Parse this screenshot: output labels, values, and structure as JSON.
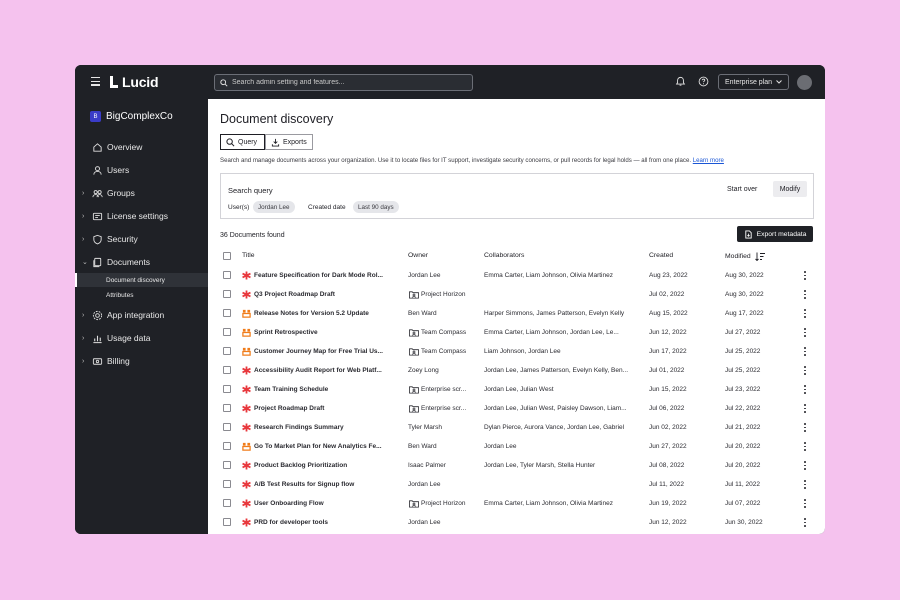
{
  "topbar": {
    "logo": "Lucid",
    "search_placeholder": "Search admin setting and features...",
    "plan_label": "Enterprise plan"
  },
  "sidebar": {
    "org_initial": "B",
    "org_name": "BigComplexCo",
    "items": [
      {
        "label": "Overview",
        "icon": "home-icon"
      },
      {
        "label": "Users",
        "icon": "user-icon"
      },
      {
        "label": "Groups",
        "icon": "groups-icon"
      },
      {
        "label": "License settings",
        "icon": "license-icon"
      },
      {
        "label": "Security",
        "icon": "shield-icon"
      },
      {
        "label": "Documents",
        "icon": "documents-icon"
      },
      {
        "label": "App integration",
        "icon": "app-integration-icon"
      },
      {
        "label": "Usage data",
        "icon": "usage-data-icon"
      },
      {
        "label": "Billing",
        "icon": "billing-icon"
      }
    ],
    "sub_items": [
      {
        "label": "Document discovery"
      },
      {
        "label": "Attributes"
      }
    ]
  },
  "main": {
    "title": "Document discovery",
    "tabs": [
      {
        "label": "Query"
      },
      {
        "label": "Exports"
      }
    ],
    "description": "Search and manage documents across your organization. Use it to locate files for IT support, investigate security concerns, or pull records for legal holds — all from one place.",
    "learn_more": "Learn more",
    "query": {
      "title": "Search query",
      "users_label": "User(s)",
      "users_value": "Jordan Lee",
      "date_label": "Created date",
      "date_value": "Last 90 days",
      "start_over": "Start over",
      "modify": "Modify"
    },
    "count_label": "36 Documents found",
    "export_label": "Export metadata",
    "columns": {
      "title": "Title",
      "owner": "Owner",
      "collaborators": "Collaborators",
      "created": "Created",
      "modified": "Modified"
    },
    "rows": [
      {
        "title": "Feature Specification for Dark Mode Rol...",
        "type": "lucidchart",
        "owner": "Jordan Lee",
        "owner_is_team": false,
        "collaborators": "Emma Carter, Liam Johnson, Olivia Martinez",
        "created": "Aug 23, 2022",
        "modified": "Aug 30, 2022"
      },
      {
        "title": "Q3 Project Roadmap Draft",
        "type": "lucidchart",
        "owner": "Project Horizon",
        "owner_is_team": true,
        "collaborators": "",
        "created": "Jul 02, 2022",
        "modified": "Aug 30, 2022"
      },
      {
        "title": "Release Notes for Version 5.2 Update",
        "type": "lucidspark",
        "owner": "Ben Ward",
        "owner_is_team": false,
        "collaborators": "Harper Simmons, James Patterson, Evelyn Kelly",
        "created": "Aug 15, 2022",
        "modified": "Aug 17, 2022"
      },
      {
        "title": "Sprint Retrospective",
        "type": "lucidspark",
        "owner": "Team Compass",
        "owner_is_team": true,
        "collaborators": "Emma Carter, Liam Johnson, Jordan Lee, Le...",
        "created": "Jun 12, 2022",
        "modified": "Jul 27, 2022"
      },
      {
        "title": "Customer Journey Map for Free Trial Us...",
        "type": "lucidspark",
        "owner": "Team Compass",
        "owner_is_team": true,
        "collaborators": "Liam Johnson, Jordan Lee",
        "created": "Jun 17, 2022",
        "modified": "Jul 25, 2022"
      },
      {
        "title": "Accessibility Audit Report for Web Platf...",
        "type": "lucidchart",
        "owner": "Zoey Long",
        "owner_is_team": false,
        "collaborators": "Jordan Lee, James Patterson, Evelyn Kelly, Ben...",
        "created": "Jul 01, 2022",
        "modified": "Jul 25, 2022"
      },
      {
        "title": "Team Training Schedule",
        "type": "lucidchart",
        "owner": "Enterprise scr...",
        "owner_is_team": true,
        "collaborators": "Jordan Lee, Julian West",
        "created": "Jun 15, 2022",
        "modified": "Jul 23, 2022"
      },
      {
        "title": "Project Roadmap Draft",
        "type": "lucidchart",
        "owner": "Enterprise scr...",
        "owner_is_team": true,
        "collaborators": "Jordan Lee, Julian West, Paisley Dawson, Liam...",
        "created": "Jul 06, 2022",
        "modified": "Jul 22, 2022"
      },
      {
        "title": "Research Findings Summary",
        "type": "lucidchart",
        "owner": "Tyler Marsh",
        "owner_is_team": false,
        "collaborators": "Dylan Pierce, Aurora Vance, Jordan Lee, Gabriel",
        "created": "Jun 02, 2022",
        "modified": "Jul 21, 2022"
      },
      {
        "title": "Go To Market Plan for New Analytics Fe...",
        "type": "lucidspark",
        "owner": "Ben Ward",
        "owner_is_team": false,
        "collaborators": "Jordan Lee",
        "created": "Jun 27, 2022",
        "modified": "Jul 20, 2022"
      },
      {
        "title": "Product Backlog Prioritization",
        "type": "lucidchart",
        "owner": "Isaac Palmer",
        "owner_is_team": false,
        "collaborators": "Jordan Lee, Tyler Marsh, Stella Hunter",
        "created": "Jul 08, 2022",
        "modified": "Jul 20, 2022"
      },
      {
        "title": "A/B Test Results for Signup flow",
        "type": "lucidchart",
        "owner": "Jordan Lee",
        "owner_is_team": false,
        "collaborators": "",
        "created": "Jul 11, 2022",
        "modified": "Jul 11, 2022"
      },
      {
        "title": "User Onboarding Flow",
        "type": "lucidchart",
        "owner": "Project Horizon",
        "owner_is_team": true,
        "collaborators": "Emma Carter, Liam Johnson, Olivia Martinez",
        "created": "Jun 19, 2022",
        "modified": "Jul 07, 2022"
      },
      {
        "title": "PRD for developer tools",
        "type": "lucidchart",
        "owner": "Jordan Lee",
        "owner_is_team": false,
        "collaborators": "",
        "created": "Jun 12, 2022",
        "modified": "Jun 30, 2022"
      }
    ]
  },
  "colors": {
    "background": "#f5c2ee",
    "chrome": "#1f2126",
    "org_badge": "#3a3cc8",
    "link": "#1a56d6",
    "lucidchart_icon": "#e8383d",
    "lucidspark_icon": "#f07c1a"
  }
}
